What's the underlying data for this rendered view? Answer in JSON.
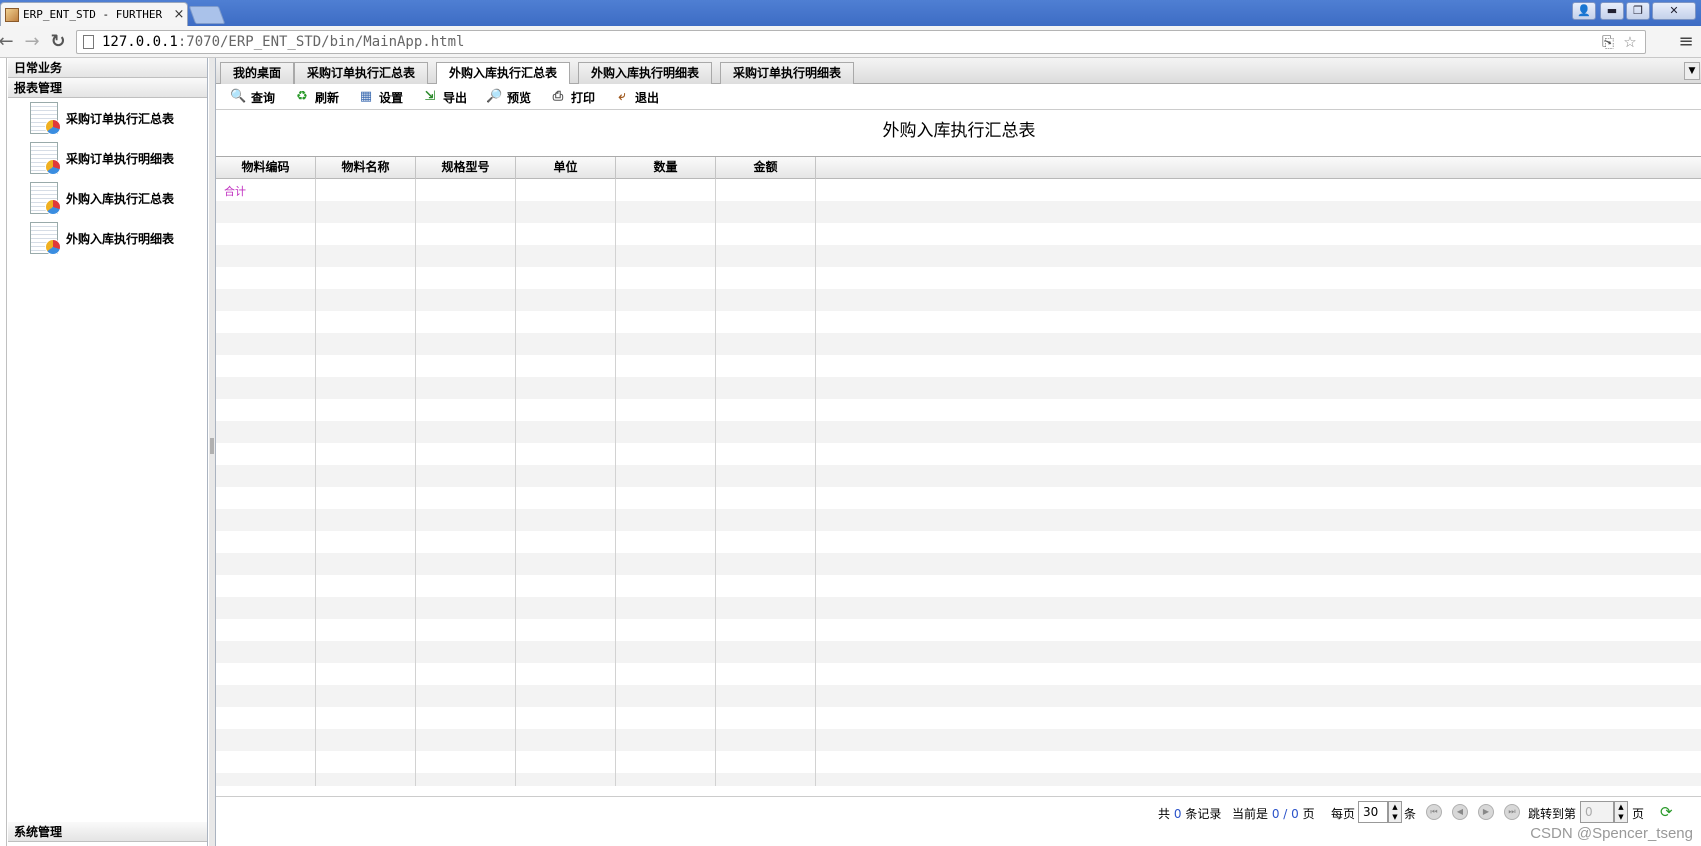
{
  "browser": {
    "tab_title": "ERP_ENT_STD - FURTHER",
    "tab_close": "×",
    "url_host": "127.0.0.1",
    "url_rest": ":7070/ERP_ENT_STD/bin/MainApp.html",
    "icons": {
      "back": "←",
      "forward": "→",
      "reload": "↻",
      "translate": "⎘",
      "star": "☆",
      "menu": "≡",
      "user": "👤",
      "minimize": "▬",
      "maximize": "❐",
      "close": "✕"
    }
  },
  "sidebar": {
    "daily_header": "日常业务",
    "report_header": "报表管理",
    "items": [
      {
        "label": "采购订单执行汇总表"
      },
      {
        "label": "采购订单执行明细表"
      },
      {
        "label": "外购入库执行汇总表"
      },
      {
        "label": "外购入库执行明细表"
      }
    ],
    "system_header": "系统管理"
  },
  "tabs": [
    {
      "label": "我的桌面",
      "active": false
    },
    {
      "label": "采购订单执行汇总表",
      "active": false
    },
    {
      "label": "外购入库执行汇总表",
      "active": true
    },
    {
      "label": "外购入库执行明细表",
      "active": false
    },
    {
      "label": "采购订单执行明细表",
      "active": false
    }
  ],
  "tab_scroll_icon": "▼",
  "commands": [
    {
      "label": "查询",
      "icon": "🔍"
    },
    {
      "label": "刷新",
      "icon": "♻"
    },
    {
      "label": "设置",
      "icon": "▦"
    },
    {
      "label": "导出",
      "icon": "⇲"
    },
    {
      "label": "预览",
      "icon": "🔎"
    },
    {
      "label": "打印",
      "icon": "⎙"
    },
    {
      "label": "退出",
      "icon": "⤶"
    }
  ],
  "report": {
    "title": "外购入库执行汇总表",
    "columns": [
      "物料编码",
      "物料名称",
      "规格型号",
      "单位",
      "数量",
      "金额"
    ],
    "total_label": "合计"
  },
  "pager": {
    "total_prefix": "共",
    "total_count": "0",
    "total_suffix": "条记录",
    "current_prefix": "当前是",
    "current_page": "0 / 0",
    "current_suffix": "页",
    "per_page_prefix": "每页",
    "per_page": "30",
    "per_page_suffix": "条",
    "jump_prefix": "跳转到第",
    "jump_value": "0",
    "jump_suffix": "页",
    "nav_first": "⏮",
    "nav_prev": "◀",
    "nav_next": "▶",
    "nav_last": "⏭",
    "refresh_icon": "⟳"
  },
  "watermark": "CSDN @Spencer_tseng"
}
